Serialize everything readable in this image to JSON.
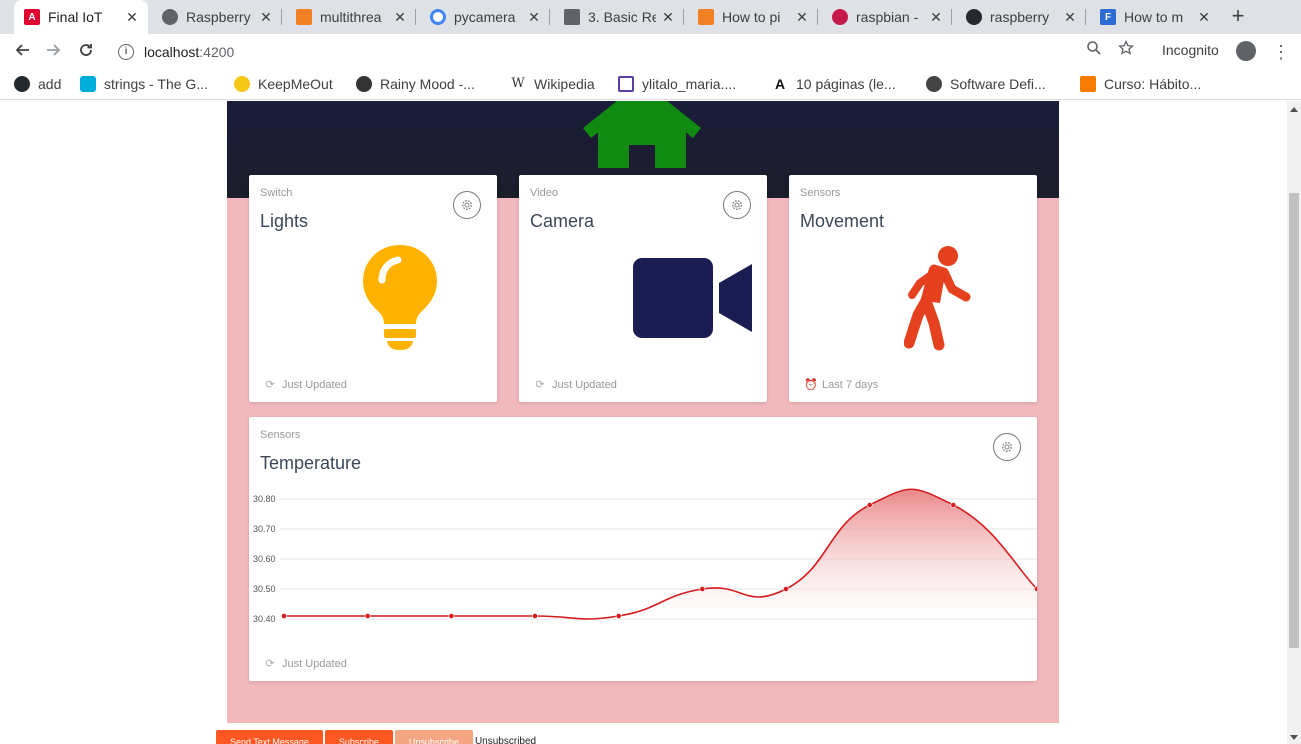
{
  "browser": {
    "tabs": [
      {
        "title": "Final IoT",
        "active": true,
        "favicon_color": "#dd0031",
        "favicon": "angular-icon"
      },
      {
        "title": "Raspberry",
        "active": false,
        "favicon_color": "#5f6368",
        "favicon": "globe-icon"
      },
      {
        "title": "multithrea",
        "active": false,
        "favicon_color": "#f48024",
        "favicon": "stackoverflow-icon"
      },
      {
        "title": "pycamera",
        "active": false,
        "favicon_color": "#4285f4",
        "favicon": "google-icon"
      },
      {
        "title": "3. Basic Re",
        "active": false,
        "favicon_color": "#5f6368",
        "favicon": "docs-icon"
      },
      {
        "title": "How to pi",
        "active": false,
        "favicon_color": "#f48024",
        "favicon": "stackoverflow-icon"
      },
      {
        "title": "raspbian -",
        "active": false,
        "favicon_color": "#c51a4a",
        "favicon": "raspberry-icon"
      },
      {
        "title": "raspberry",
        "active": false,
        "favicon_color": "#24292e",
        "favicon": "github-icon"
      },
      {
        "title": "How to m",
        "active": false,
        "favicon_color": "#2b6cd4",
        "favicon": "f-icon"
      }
    ],
    "address": {
      "host": "localhost",
      "port": ":4200"
    },
    "incognito_label": "Incognito",
    "bookmarks": [
      {
        "label": "add",
        "color": "#24292e"
      },
      {
        "label": "strings - The G...",
        "color": "#00add8"
      },
      {
        "label": "KeepMeOut",
        "color": "#f5c518"
      },
      {
        "label": "Rainy Mood -...",
        "color": "#333"
      },
      {
        "label": "Wikipedia",
        "color": "#666"
      },
      {
        "label": "ylitalo_maria....",
        "color": "#5b3fa0"
      },
      {
        "label": "10 páginas (le...",
        "color": "#111"
      },
      {
        "label": "Software Defi...",
        "color": "#444"
      },
      {
        "label": "Curso: Hábito...",
        "color": "#f57c00"
      }
    ]
  },
  "cards": {
    "lights": {
      "category": "Switch",
      "title": "Lights",
      "footer": "Just Updated",
      "icon": "lightbulb-icon",
      "color": "#ffb300"
    },
    "camera": {
      "category": "Video",
      "title": "Camera",
      "footer": "Just Updated",
      "icon": "videocam-icon",
      "color": "#1a1d52"
    },
    "movement": {
      "category": "Sensors",
      "title": "Movement",
      "footer": "Last 7 days",
      "icon": "walking-icon",
      "color": "#e5411f"
    },
    "temperature": {
      "category": "Sensors",
      "title": "Temperature",
      "footer": "Just Updated"
    }
  },
  "chart_data": {
    "type": "area",
    "ylim": [
      30.4,
      30.8
    ],
    "yticks": [
      "30.80",
      "30.70",
      "30.60",
      "30.50",
      "30.40"
    ],
    "series": [
      {
        "values": [
          30.41,
          30.41,
          30.41,
          30.41,
          30.41,
          30.5,
          30.5,
          30.78,
          30.78,
          30.5
        ]
      }
    ],
    "line_color": "#d41c1c",
    "fill_color": "#e57373",
    "grid": true
  },
  "bottom_buttons": [
    {
      "label": "Send Text Message",
      "color": "#ff5722"
    },
    {
      "label": "Subscribe",
      "color": "#ff5722"
    },
    {
      "label": "Unsubscribe",
      "color": "#f4a582"
    }
  ],
  "subscription_status": "Unsubscribed",
  "theme": {
    "header_dark": "#1a1c3a",
    "pink_bg": "#f2b9bd",
    "home_icon_color": "#108a10"
  }
}
